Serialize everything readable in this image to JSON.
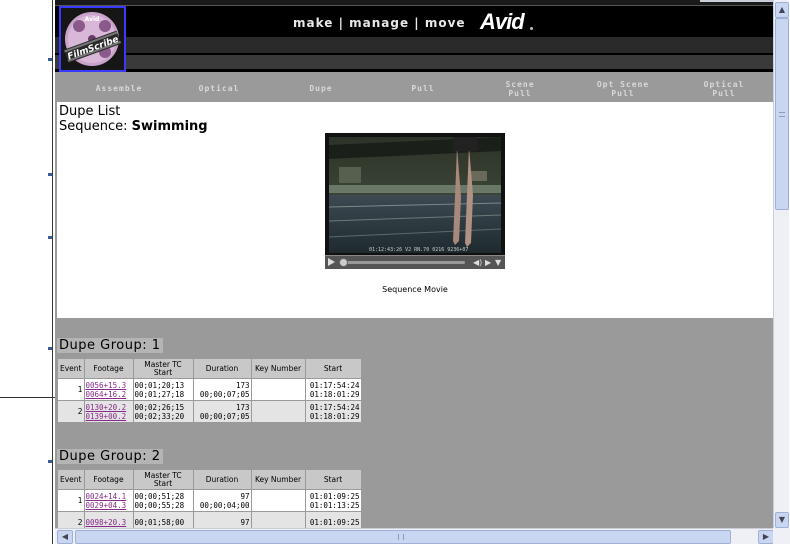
{
  "header": {
    "tagline": "make | manage | move",
    "brand": "Avid",
    "logo_text": "FilmScribe",
    "logo_badge": "Avid"
  },
  "nav": {
    "items": [
      "Assemble",
      "Optical",
      "Dupe",
      "Pull"
    ],
    "scene_pull": [
      "Scene",
      "Pull"
    ],
    "opt_scene_pull": [
      "Opt Scene",
      "Pull"
    ],
    "optical_pull": [
      "Optical",
      "Pull"
    ]
  },
  "page": {
    "title": "Dupe List",
    "sequence_label": "Sequence:",
    "sequence_name": "Swimming"
  },
  "player": {
    "timecode_overlay": "01:12:43:26  V2     RN.70 0216 9236+07",
    "caption": "Sequence Movie"
  },
  "columns": [
    "Event",
    "Footage",
    "Master TC Start",
    "Duration",
    "Key Number",
    "Start"
  ],
  "columns_master": [
    "Master TC",
    "Start"
  ],
  "groups": [
    {
      "title": "Dupe Group: 1",
      "rows": [
        {
          "event": "1",
          "footage": [
            "0056+15.3",
            "0064+16.2"
          ],
          "master_tc": [
            "00;01;20;13",
            "00;01;27;18"
          ],
          "duration": [
            "173",
            "00;00;07;05"
          ],
          "key_number": "",
          "start": [
            "01:17:54:24",
            "01:18:01:29"
          ]
        },
        {
          "event": "2",
          "footage": [
            "0130+20.2",
            "0139+00.2"
          ],
          "master_tc": [
            "00;02;26;15",
            "00;02;33;20"
          ],
          "duration": [
            "173",
            "00;00;07;05"
          ],
          "key_number": "",
          "start": [
            "01:17:54:24",
            "01:18:01:29"
          ]
        }
      ]
    },
    {
      "title": "Dupe Group: 2",
      "rows": [
        {
          "event": "1",
          "footage": [
            "0024+14.1",
            "0029+04.3"
          ],
          "master_tc": [
            "00;00;51;28",
            "00;00;55;28"
          ],
          "duration": [
            "97",
            "00;00;04;00"
          ],
          "key_number": "",
          "start": [
            "01:01:09:25",
            "01:01:13:25"
          ]
        },
        {
          "event": "2",
          "footage": [
            "0098+20.3"
          ],
          "master_tc": [
            "00;01;58;00"
          ],
          "duration": [
            "97"
          ],
          "key_number": "",
          "start": [
            "01:01:09:25"
          ]
        }
      ]
    }
  ]
}
